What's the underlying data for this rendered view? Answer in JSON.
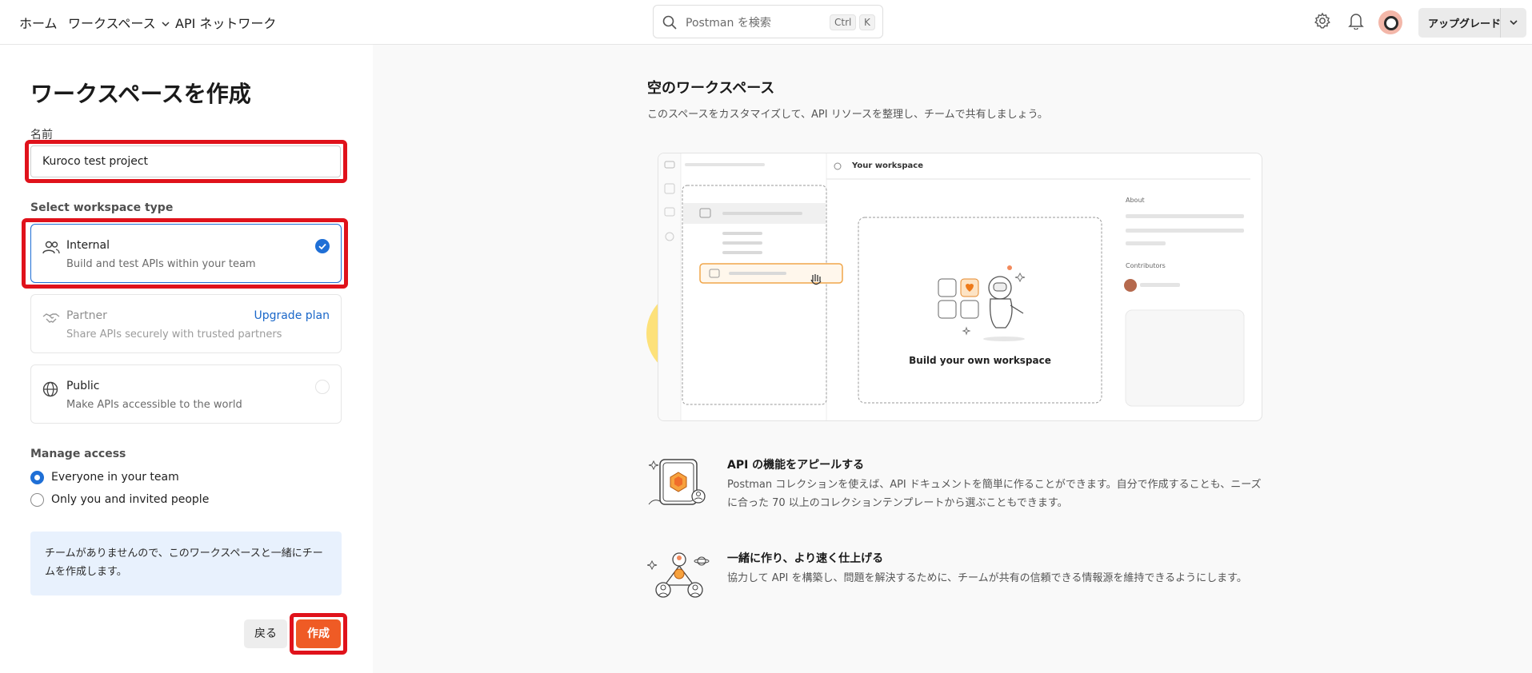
{
  "nav": {
    "home": "ホーム",
    "workspaces": "ワークスペース",
    "api_network": "API ネットワーク"
  },
  "search": {
    "placeholder": "Postman を検索",
    "shortcut_ctrl": "Ctrl",
    "shortcut_key": "K"
  },
  "header": {
    "upgrade_label": "アップグレード",
    "icons": [
      "gear-icon",
      "bell-icon",
      "avatar",
      "chevron-down-icon"
    ]
  },
  "form": {
    "title": "ワークスペースを作成",
    "name_label": "名前",
    "name_value": "Kuroco test project",
    "type_label": "Select workspace type",
    "types": [
      {
        "title": "Internal",
        "desc": "Build and test APIs within your team",
        "selected": true
      },
      {
        "title": "Partner",
        "desc": "Share APIs securely with trusted partners",
        "link": "Upgrade plan",
        "disabled": true
      },
      {
        "title": "Public",
        "desc": "Make APIs accessible to the world"
      }
    ],
    "access_label": "Manage access",
    "access_options": [
      {
        "label": "Everyone in your team",
        "selected": true
      },
      {
        "label": "Only you and invited people",
        "selected": false
      }
    ],
    "info": "チームがありませんので、このワークスペースと一緒にチームを作成します。",
    "back_label": "戻る",
    "create_label": "作成"
  },
  "preview": {
    "title": "空のワークスペース",
    "subtitle": "このスペースをカスタマイズして、API リソースを整理し、チームで共有しましょう。",
    "illustration": {
      "workspace_label": "Your workspace",
      "build_label": "Build your own workspace",
      "about_label": "About",
      "contributors_label": "Contributors"
    },
    "features": [
      {
        "title": "API の機能をアピールする",
        "desc": "Postman コレクションを使えば、API ドキュメントを簡単に作ることができます。自分で作成することも、ニーズに合った 70 以上のコレクションテンプレートから選ぶこともできます。"
      },
      {
        "title": "一緒に作り、より速く仕上げる",
        "desc": "協力して API を構築し、問題を解決するために、チームが共有の信頼できる情報源を維持できるようにします。"
      }
    ]
  },
  "colors": {
    "accent_orange": "#ef5b25",
    "selected_blue": "#1f6fd6",
    "highlight_red": "#e0121b",
    "info_bg": "#e8f1fd"
  }
}
